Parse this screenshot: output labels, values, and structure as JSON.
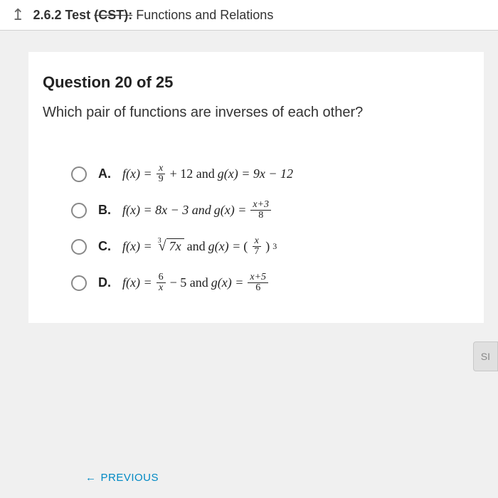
{
  "header": {
    "section": "2.6.2",
    "testLabel": "Test",
    "cst": "(CST):",
    "title": "Functions and Relations"
  },
  "question": {
    "number": "Question 20 of 25",
    "text": "Which pair of functions are inverses of each other?"
  },
  "options": {
    "a": {
      "label": "A.",
      "fx": "f(x) =",
      "frac_num": "x",
      "frac_den": "9",
      "mid": "+ 12 and",
      "gx": "g(x) = 9x − 12"
    },
    "b": {
      "label": "B.",
      "fx": "f(x) = 8x − 3 and",
      "gx": "g(x) =",
      "frac_num": "x+3",
      "frac_den": "8"
    },
    "c": {
      "label": "C.",
      "fx": "f(x) =",
      "index": "3",
      "radicand": "7x",
      "mid": "and",
      "gx": "g(x) =",
      "frac_num": "x",
      "frac_den": "7",
      "exp": "3"
    },
    "d": {
      "label": "D.",
      "fx": "f(x) =",
      "frac1_num": "6",
      "frac1_den": "x",
      "mid": "− 5 and",
      "gx": "g(x) =",
      "frac2_num": "x+5",
      "frac2_den": "6"
    }
  },
  "buttons": {
    "side": "SI",
    "previous": "PREVIOUS"
  }
}
